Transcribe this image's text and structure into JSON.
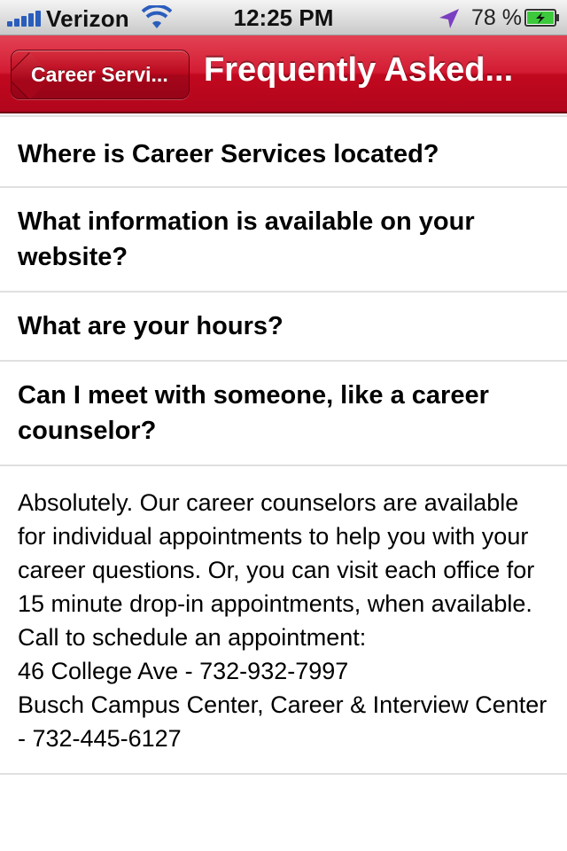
{
  "status_bar": {
    "carrier": "Verizon",
    "time": "12:25 PM",
    "battery_percent": "78 %",
    "icons": [
      "signal-icon",
      "wifi-icon",
      "location-icon",
      "battery-icon"
    ]
  },
  "nav": {
    "back_label": "Career Servi...",
    "title": "Frequently Asked..."
  },
  "faq": {
    "items": [
      {
        "question": "Where is Career Services located?"
      },
      {
        "question": "What information is available on your website?"
      },
      {
        "question": "What are your hours?"
      },
      {
        "question": "Can I meet with someone, like a career counselor?"
      }
    ],
    "answer": "Absolutely.  Our career counselors are available for individual appointments to help you with your career questions.  Or, you can visit each office for 15 minute drop-in appointments, when available.  Call to schedule an appointment:\n 46 College Ave - 732-932-7997\nBusch Campus Center, Career & Interview Center - 732-445-6127"
  },
  "colors": {
    "nav_red": "#c1081f",
    "battery_green": "#3cc93c",
    "signal_blue": "#2a5dbd",
    "location_purple": "#7a3fc0"
  }
}
